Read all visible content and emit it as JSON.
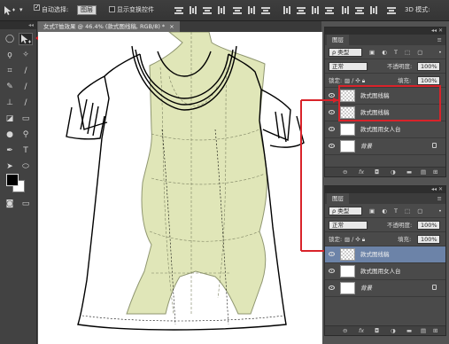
{
  "options_bar": {
    "tool_icon": "move-tool-icon",
    "auto_select_label": "自动选择:",
    "auto_select_value": "图层",
    "show_transform_label": "显示变换控件",
    "mode_3d_label": "3D 模式:"
  },
  "document": {
    "tab_title": "女式T恤效果 @ 46.4% (款式图线稿, RGB/8) *"
  },
  "tools_panel": {
    "collapse_label": "◂◂"
  },
  "layers_panel_top": {
    "tab_label": "图层",
    "filter_label": "类型",
    "blend_mode": "正常",
    "opacity_label": "不透明度:",
    "opacity_value": "100%",
    "lock_label": "锁定:",
    "fill_label": "填充:",
    "fill_value": "100%",
    "layers": [
      {
        "name": "款式图线稿",
        "selected": false
      },
      {
        "name": "款式图线稿",
        "selected": false
      },
      {
        "name": "款式图用女人台",
        "selected": false
      },
      {
        "name": "背景",
        "selected": false,
        "locked": true
      }
    ],
    "footer_icons": [
      "link-icon",
      "fx",
      "mask-icon",
      "adjustment-icon",
      "group-icon",
      "new-layer-icon",
      "trash-icon"
    ]
  },
  "layers_panel_bottom": {
    "tab_label": "图层",
    "filter_label": "类型",
    "blend_mode": "正常",
    "opacity_label": "不透明度:",
    "opacity_value": "100%",
    "lock_label": "锁定:",
    "fill_label": "填充:",
    "fill_value": "100%",
    "layers": [
      {
        "name": "款式图线稿",
        "selected": true
      },
      {
        "name": "款式图用女人台",
        "selected": false
      },
      {
        "name": "背景",
        "selected": false,
        "locked": true
      }
    ]
  },
  "colors": {
    "annotation_red": "#d9232a",
    "mannequin_fill": "#e0e6b8",
    "selected_layer": "#6c83a8",
    "panel_bg": "#4a4a4a"
  }
}
